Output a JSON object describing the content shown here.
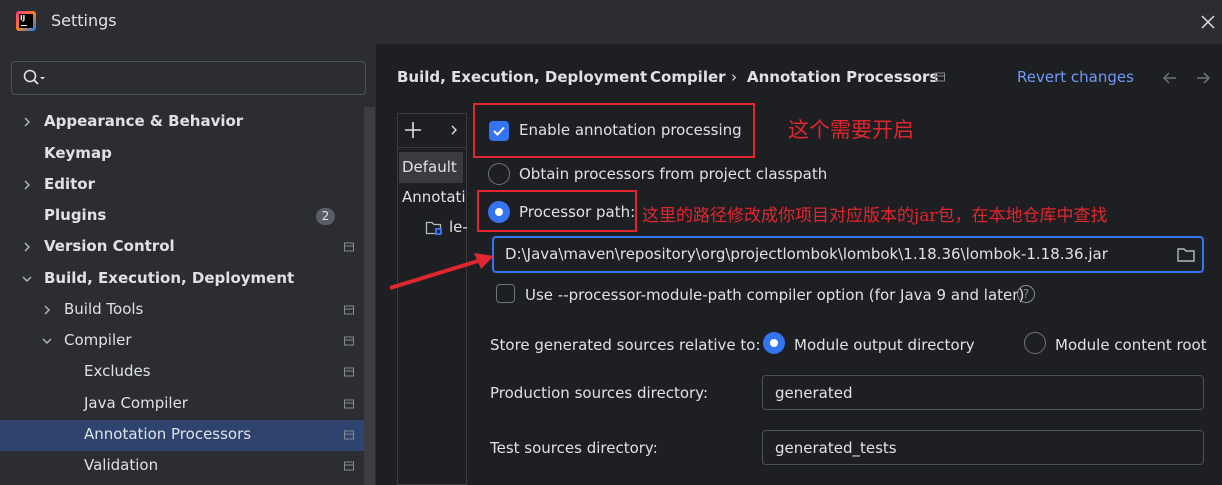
{
  "window": {
    "title": "Settings"
  },
  "search": {
    "placeholder": ""
  },
  "sidebar": {
    "items": [
      {
        "label": "Appearance & Behavior"
      },
      {
        "label": "Keymap"
      },
      {
        "label": "Editor"
      },
      {
        "label": "Plugins",
        "badge": "2"
      },
      {
        "label": "Version Control"
      },
      {
        "label": "Build, Execution, Deployment"
      },
      {
        "label": "Build Tools"
      },
      {
        "label": "Compiler"
      },
      {
        "label": "Excludes"
      },
      {
        "label": "Java Compiler"
      },
      {
        "label": "Annotation Processors"
      },
      {
        "label": "Validation"
      }
    ]
  },
  "breadcrumb": {
    "items": [
      "Build, Execution, Deployment",
      "Compiler",
      "Annotation Processors"
    ],
    "separator": "›"
  },
  "header": {
    "revert_label": "Revert changes"
  },
  "profiles": {
    "default_label": "Default",
    "annotation_label": "Annotatio",
    "module_label": "le-"
  },
  "options": {
    "enable_label": "Enable annotation processing",
    "enable_checked": true,
    "obtain_label": "Obtain processors from project classpath",
    "processor_path_label": "Processor path:",
    "processor_path_value": "D:\\Java\\maven\\repository\\org\\projectlombok\\lombok\\1.18.36\\lombok-1.18.36.jar",
    "module_path_label": "Use --processor-module-path compiler option (for Java 9 and later)",
    "store_label": "Store generated sources relative to:",
    "module_output_label": "Module output directory",
    "module_content_label": "Module content root",
    "production_label": "Production sources directory:",
    "production_value": "generated",
    "test_label": "Test sources directory:",
    "test_value": "generated_tests"
  },
  "annotations": {
    "note_enable": "这个需要开启",
    "note_path": "这里的路径修改成你项目对应版本的jar包，在本地仓库中查找"
  },
  "colors": {
    "accent": "#3574f0",
    "annotation_red": "#e0262e",
    "link": "#6e9bf5"
  }
}
